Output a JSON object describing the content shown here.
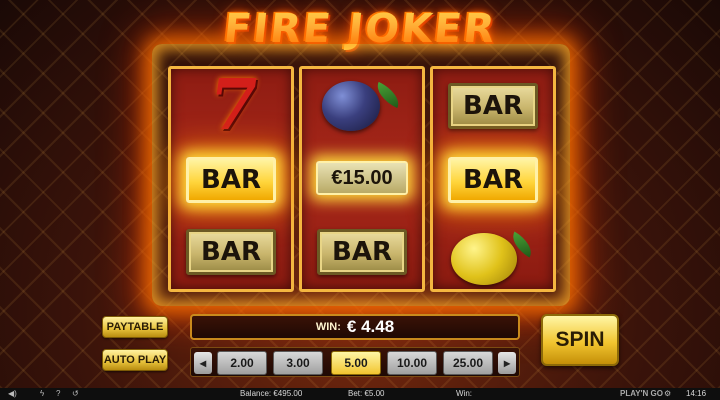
{
  "game": {
    "logo_text": "FIRE JOKER"
  },
  "reels": [
    {
      "symbols": [
        "seven",
        "BAR",
        "BAR"
      ]
    },
    {
      "symbols": [
        "plum",
        "€15.00",
        "BAR"
      ]
    },
    {
      "symbols": [
        "BAR",
        "BAR",
        "lemon"
      ]
    }
  ],
  "symbol_labels": {
    "bar": "BAR",
    "seven": "7",
    "win_amount": "€15.00"
  },
  "buttons": {
    "paytable": "PAYTABLE",
    "autoplay": "AUTO PLAY",
    "spin": "SPIN"
  },
  "win": {
    "label": "WIN:",
    "value": "€ 4.48"
  },
  "bets": {
    "options": [
      "2.00",
      "3.00",
      "5.00",
      "10.00",
      "25.00"
    ],
    "selected": "5.00",
    "left_arrow": "◂",
    "right_arrow": "▸"
  },
  "status_bar": {
    "balance": "Balance: €495.00",
    "bet": "Bet: €5.00",
    "win": "Win:",
    "brand": "PLAY'N GO",
    "time": "14:16",
    "icons": [
      "speaker-icon",
      "lightning-icon",
      "history-icon"
    ]
  },
  "colors": {
    "reel_bg": "#a9281a",
    "gold": "#f2c530",
    "flame": "#ff7a00"
  }
}
